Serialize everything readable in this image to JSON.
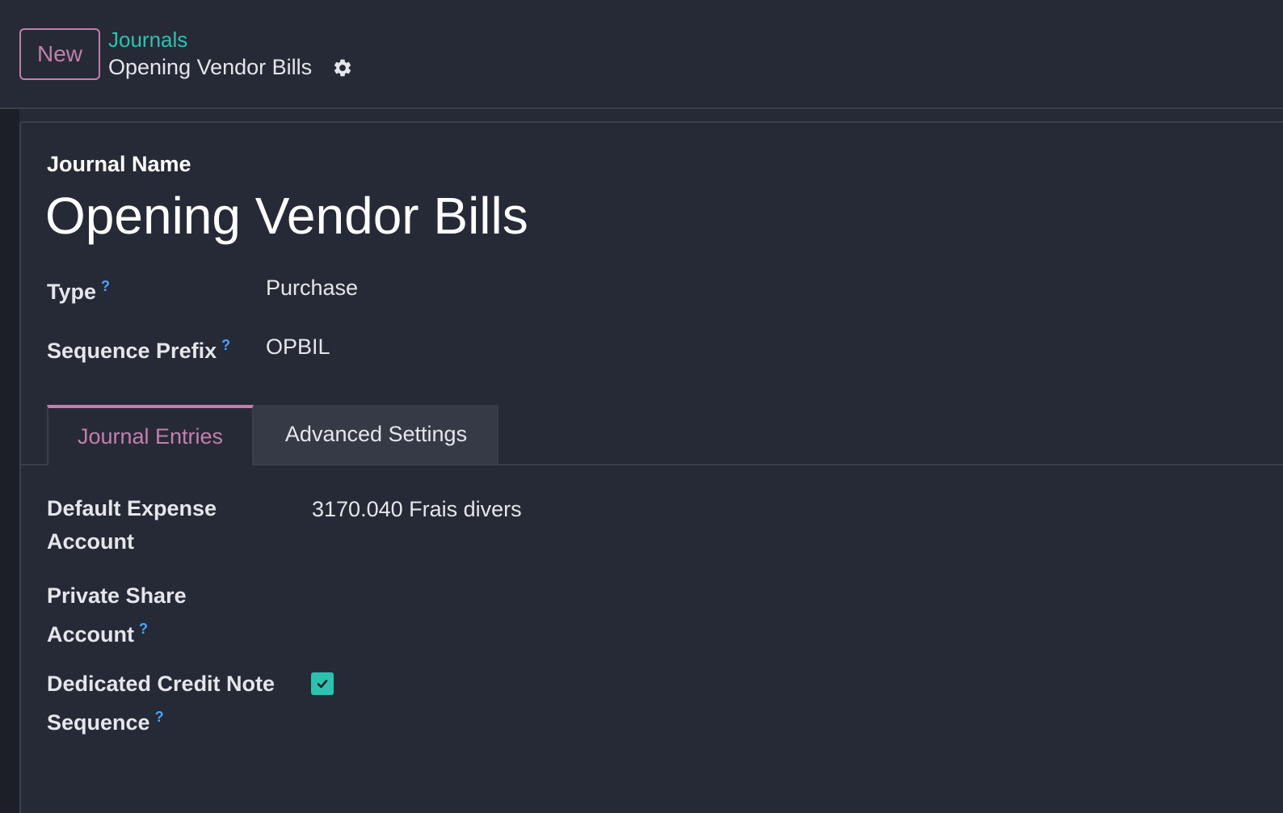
{
  "control_panel": {
    "new_button": "New",
    "breadcrumb_parent": "Journals",
    "breadcrumb_current": "Opening Vendor Bills"
  },
  "form": {
    "name_caption": "Journal Name",
    "name_value": "Opening Vendor Bills",
    "type_label": "Type",
    "type_value": "Purchase",
    "prefix_label": "Sequence Prefix",
    "prefix_value": "OPBIL",
    "help_mark": "?"
  },
  "tabs": [
    {
      "label": "Journal Entries",
      "active": true
    },
    {
      "label": "Advanced Settings",
      "active": false
    }
  ],
  "journal_entries": {
    "expense_label_line1": "Default Expense",
    "expense_label_line2": "Account",
    "expense_value": "3170.040 Frais divers",
    "private_label_line1": "Private Share",
    "private_label_line2": "Account",
    "credit_label_line1": "Dedicated Credit Note",
    "credit_label_line2": "Sequence",
    "credit_checked": true
  },
  "colors": {
    "accent": "#c27fad",
    "link": "#2dc2b0",
    "help": "#4ca3ff",
    "background": "#262a36"
  }
}
